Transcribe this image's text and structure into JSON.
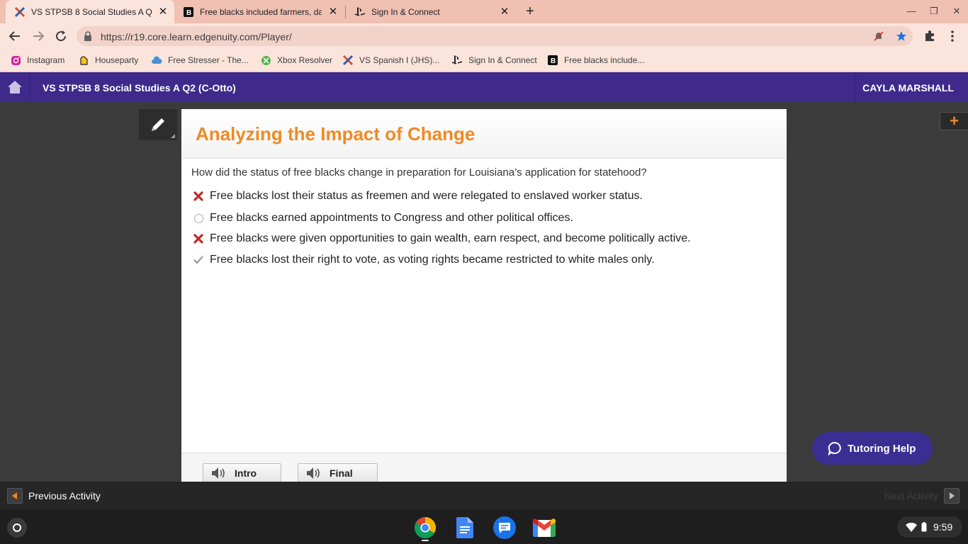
{
  "browser": {
    "tabs": [
      {
        "title": "VS STPSB 8 Social Studies A Q2",
        "icon": "edgenuity-x-icon",
        "active": true
      },
      {
        "title": "Free blacks included farmers, da",
        "icon": "brainly-b-icon",
        "active": false
      },
      {
        "title": "Sign In & Connect",
        "icon": "playstation-icon",
        "active": false
      }
    ],
    "url": "https://r19.core.learn.edgenuity.com/Player/",
    "bookmarks": [
      {
        "label": "Instagram",
        "icon": "instagram-icon"
      },
      {
        "label": "Houseparty",
        "icon": "houseparty-icon"
      },
      {
        "label": "Free Stresser - The...",
        "icon": "cloud-icon"
      },
      {
        "label": "Xbox Resolver",
        "icon": "xbox-icon"
      },
      {
        "label": "VS Spanish I (JHS)...",
        "icon": "edgenuity-x-icon"
      },
      {
        "label": "Sign In & Connect",
        "icon": "playstation-icon"
      },
      {
        "label": "Free blacks include...",
        "icon": "brainly-b-icon"
      }
    ]
  },
  "header": {
    "course_title": "VS STPSB 8 Social Studies A Q2 (C-Otto)",
    "user_name": "CAYLA MARSHALL"
  },
  "lesson": {
    "title": "Analyzing the Impact of Change",
    "question": "How did the status of free blacks change in preparation for Louisiana’s application for statehood?",
    "answers": [
      {
        "text": "Free blacks lost their status as freemen and were relegated to enslaved worker status.",
        "state": "incorrect"
      },
      {
        "text": "Free blacks earned appointments to Congress and other political offices.",
        "state": "unselected"
      },
      {
        "text": "Free blacks were given opportunities to gain wealth, earn respect, and become politically active.",
        "state": "incorrect"
      },
      {
        "text": "Free blacks lost their right to vote, as voting rights became restricted to white males only.",
        "state": "correct"
      }
    ],
    "audio_buttons": {
      "intro": "Intro",
      "final": "Final"
    }
  },
  "tutoring": {
    "label": "Tutoring Help"
  },
  "nav": {
    "previous": "Previous Activity",
    "next": "Next Activity"
  },
  "shelf": {
    "time": "9:59"
  },
  "colors": {
    "header_purple": "#3f2a8c",
    "title_orange": "#f08a24",
    "incorrect_red": "#c62828",
    "tab_strip": "#f0c0b2"
  }
}
